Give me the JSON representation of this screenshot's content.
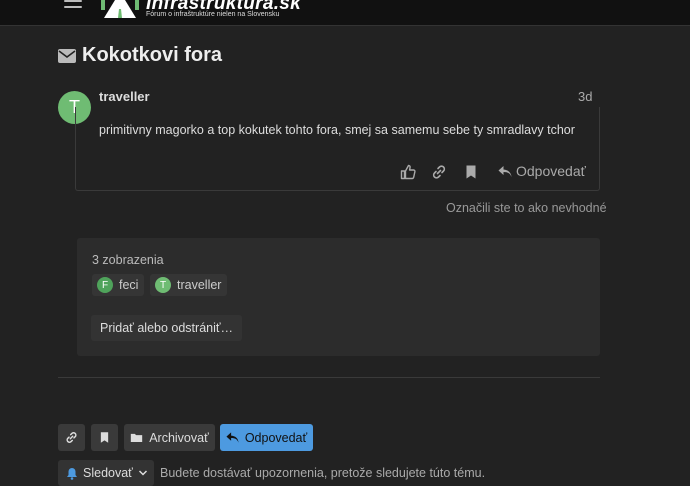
{
  "header": {
    "site_title": "Infraštruktúra.sk",
    "site_subtitle": "Fórum o infraštruktúre nielen na Slovensku"
  },
  "topic": {
    "title": "Kokotkovi fora",
    "icon": "envelope-icon"
  },
  "post": {
    "avatar_letter": "T",
    "avatar_color": "#6fbc73",
    "username": "traveller",
    "date": "3d",
    "text": "primitivny magorko a top kokutek tohto fora, smej sa samemu sebe ty smradlavy tchor",
    "actions": {
      "like_icon": "thumbs-up-icon",
      "link_icon": "link-icon",
      "bookmark_icon": "bookmark-icon",
      "reply_label": "Odpovedať"
    },
    "flagged_notice": "Označili ste to ako nevhodné"
  },
  "summary": {
    "views": "3 zobrazenia",
    "participants": [
      {
        "letter": "F",
        "name": "feci",
        "color": "#4fa35b"
      },
      {
        "letter": "T",
        "name": "traveller",
        "color": "#6fbc73"
      }
    ],
    "add_remove_label": "Pridať alebo odstrániť…"
  },
  "footer": {
    "archive_label": "Archivovať",
    "reply_label": "Odpovedať",
    "accent": "#4d9ae0",
    "notification_label": "Sledovať",
    "notification_text": "Budete dostávať upozornenia, pretože sledujete túto tému."
  }
}
